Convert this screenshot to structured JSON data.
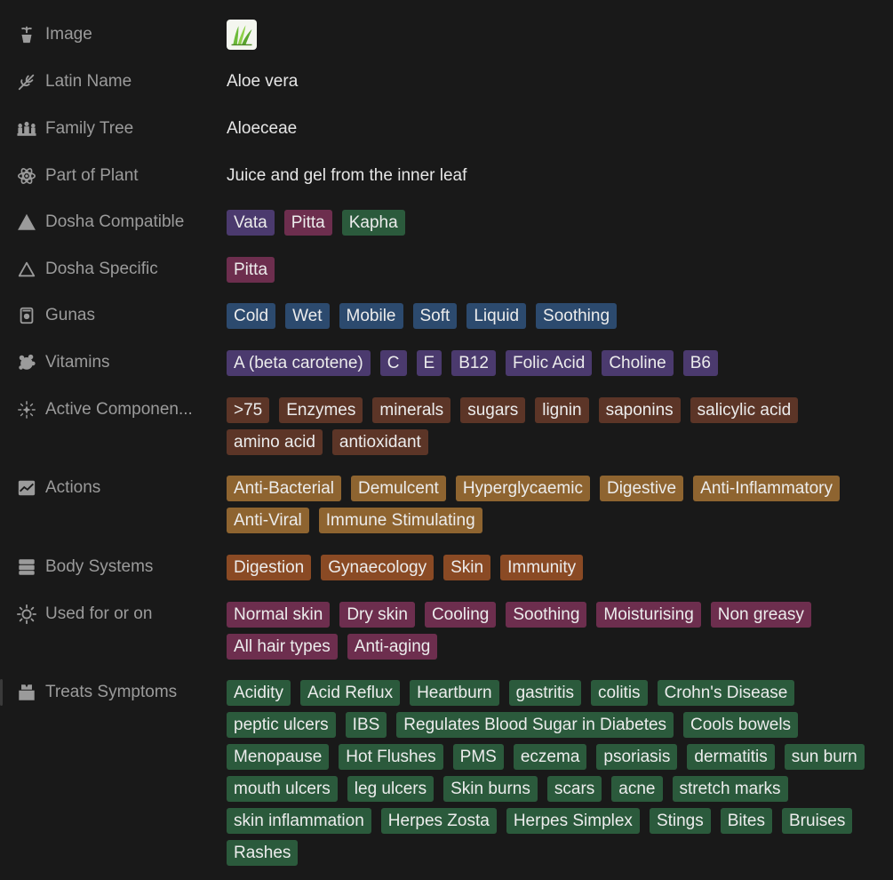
{
  "colors": {
    "background": "#191919",
    "label": "#9b9b9b",
    "text": "#e6e6e6",
    "purple": "#4b3a6e",
    "pink": "#6d2e4e",
    "green": "#2b5a3c",
    "blue": "#2c4a6e",
    "brown": "#5c3527",
    "orange": "#8e6430",
    "rust": "#8a4a24"
  },
  "properties": {
    "image": {
      "label": "Image",
      "icon": "plant-pot-icon"
    },
    "latin_name": {
      "label": "Latin Name",
      "icon": "branch-icon",
      "value": "Aloe vera"
    },
    "family_tree": {
      "label": "Family Tree",
      "icon": "people-icon",
      "value": "Aloeceae"
    },
    "part_of_plant": {
      "label": "Part of Plant",
      "icon": "atom-icon",
      "value": "Juice and gel from the inner leaf"
    },
    "dosha_compatible": {
      "label": "Dosha Compatible",
      "icon": "filled-triangle-icon"
    },
    "dosha_specific": {
      "label": "Dosha Specific",
      "icon": "outline-triangle-icon"
    },
    "gunas": {
      "label": "Gunas",
      "icon": "jar-icon"
    },
    "vitamins": {
      "label": "Vitamins",
      "icon": "virus-icon"
    },
    "active_components": {
      "label": "Active Componen...",
      "icon": "sparkle-icon"
    },
    "actions": {
      "label": "Actions",
      "icon": "chart-icon"
    },
    "body_systems": {
      "label": "Body Systems",
      "icon": "server-icon"
    },
    "used_for": {
      "label": "Used for or on",
      "icon": "sun-icon"
    },
    "treats_symptoms": {
      "label": "Treats Symptoms",
      "icon": "bandage-icon"
    }
  },
  "tag_groups": {
    "dosha_compatible": [
      {
        "text": "Vata",
        "color": "#4b3a6e"
      },
      {
        "text": "Pitta",
        "color": "#6d2e4e"
      },
      {
        "text": "Kapha",
        "color": "#2b5a3c"
      }
    ],
    "dosha_specific": [
      {
        "text": "Pitta",
        "color": "#6d2e4e"
      }
    ],
    "gunas": [
      {
        "text": "Cold",
        "color": "#2c4a6e"
      },
      {
        "text": "Wet",
        "color": "#2c4a6e"
      },
      {
        "text": "Mobile",
        "color": "#2c4a6e"
      },
      {
        "text": "Soft",
        "color": "#2c4a6e"
      },
      {
        "text": "Liquid",
        "color": "#2c4a6e"
      },
      {
        "text": "Soothing",
        "color": "#2c4a6e"
      }
    ],
    "vitamins": [
      {
        "text": "A (beta carotene)",
        "color": "#4b3a6e"
      },
      {
        "text": "C",
        "color": "#4b3a6e"
      },
      {
        "text": "E",
        "color": "#4b3a6e"
      },
      {
        "text": "B12",
        "color": "#4b3a6e"
      },
      {
        "text": "Folic Acid",
        "color": "#4b3a6e"
      },
      {
        "text": "Choline",
        "color": "#4b3a6e"
      },
      {
        "text": "B6",
        "color": "#4b3a6e"
      }
    ],
    "active_components": [
      {
        "text": ">75",
        "color": "#5c3527"
      },
      {
        "text": "Enzymes",
        "color": "#5c3527"
      },
      {
        "text": "minerals",
        "color": "#5c3527"
      },
      {
        "text": "sugars",
        "color": "#5c3527"
      },
      {
        "text": "lignin",
        "color": "#5c3527"
      },
      {
        "text": "saponins",
        "color": "#5c3527"
      },
      {
        "text": "salicylic acid",
        "color": "#5c3527"
      },
      {
        "text": "amino acid",
        "color": "#5c3527"
      },
      {
        "text": "antioxidant",
        "color": "#5c3527"
      }
    ],
    "actions": [
      {
        "text": "Anti-Bacterial",
        "color": "#8e6430"
      },
      {
        "text": "Demulcent",
        "color": "#8e6430"
      },
      {
        "text": "Hyperglycaemic",
        "color": "#8e6430"
      },
      {
        "text": "Digestive",
        "color": "#8e6430"
      },
      {
        "text": "Anti-Inflammatory",
        "color": "#8e6430"
      },
      {
        "text": "Anti-Viral",
        "color": "#8e6430"
      },
      {
        "text": "Immune Stimulating",
        "color": "#8e6430"
      }
    ],
    "body_systems": [
      {
        "text": "Digestion",
        "color": "#8a4a24"
      },
      {
        "text": "Gynaecology",
        "color": "#8a4a24"
      },
      {
        "text": "Skin",
        "color": "#8a4a24"
      },
      {
        "text": "Immunity",
        "color": "#8a4a24"
      }
    ],
    "used_for": [
      {
        "text": "Normal skin",
        "color": "#6d2e4e"
      },
      {
        "text": "Dry skin",
        "color": "#6d2e4e"
      },
      {
        "text": "Cooling",
        "color": "#6d2e4e"
      },
      {
        "text": "Soothing",
        "color": "#6d2e4e"
      },
      {
        "text": "Moisturising",
        "color": "#6d2e4e"
      },
      {
        "text": "Non greasy",
        "color": "#6d2e4e"
      },
      {
        "text": "All hair types",
        "color": "#6d2e4e"
      },
      {
        "text": "Anti-aging",
        "color": "#6d2e4e"
      }
    ],
    "treats_symptoms": [
      {
        "text": "Acidity",
        "color": "#2b5a3c"
      },
      {
        "text": "Acid Reflux",
        "color": "#2b5a3c"
      },
      {
        "text": "Heartburn",
        "color": "#2b5a3c"
      },
      {
        "text": "gastritis",
        "color": "#2b5a3c"
      },
      {
        "text": "colitis",
        "color": "#2b5a3c"
      },
      {
        "text": "Crohn's Disease",
        "color": "#2b5a3c"
      },
      {
        "text": "peptic ulcers",
        "color": "#2b5a3c"
      },
      {
        "text": "IBS",
        "color": "#2b5a3c"
      },
      {
        "text": "Regulates Blood Sugar in Diabetes",
        "color": "#2b5a3c"
      },
      {
        "text": "Cools bowels",
        "color": "#2b5a3c"
      },
      {
        "text": "Menopause",
        "color": "#2b5a3c"
      },
      {
        "text": "Hot Flushes",
        "color": "#2b5a3c"
      },
      {
        "text": "PMS",
        "color": "#2b5a3c"
      },
      {
        "text": "eczema",
        "color": "#2b5a3c"
      },
      {
        "text": "psoriasis",
        "color": "#2b5a3c"
      },
      {
        "text": "dermatitis",
        "color": "#2b5a3c"
      },
      {
        "text": "sun burn",
        "color": "#2b5a3c"
      },
      {
        "text": "mouth ulcers",
        "color": "#2b5a3c"
      },
      {
        "text": "leg ulcers",
        "color": "#2b5a3c"
      },
      {
        "text": "Skin burns",
        "color": "#2b5a3c"
      },
      {
        "text": "scars",
        "color": "#2b5a3c"
      },
      {
        "text": "acne",
        "color": "#2b5a3c"
      },
      {
        "text": "stretch marks",
        "color": "#2b5a3c"
      },
      {
        "text": "skin inflammation",
        "color": "#2b5a3c"
      },
      {
        "text": "Herpes Zosta",
        "color": "#2b5a3c"
      },
      {
        "text": "Herpes Simplex",
        "color": "#2b5a3c"
      },
      {
        "text": "Stings",
        "color": "#2b5a3c"
      },
      {
        "text": "Bites",
        "color": "#2b5a3c"
      },
      {
        "text": "Bruises",
        "color": "#2b5a3c"
      },
      {
        "text": "Rashes",
        "color": "#2b5a3c"
      }
    ]
  }
}
